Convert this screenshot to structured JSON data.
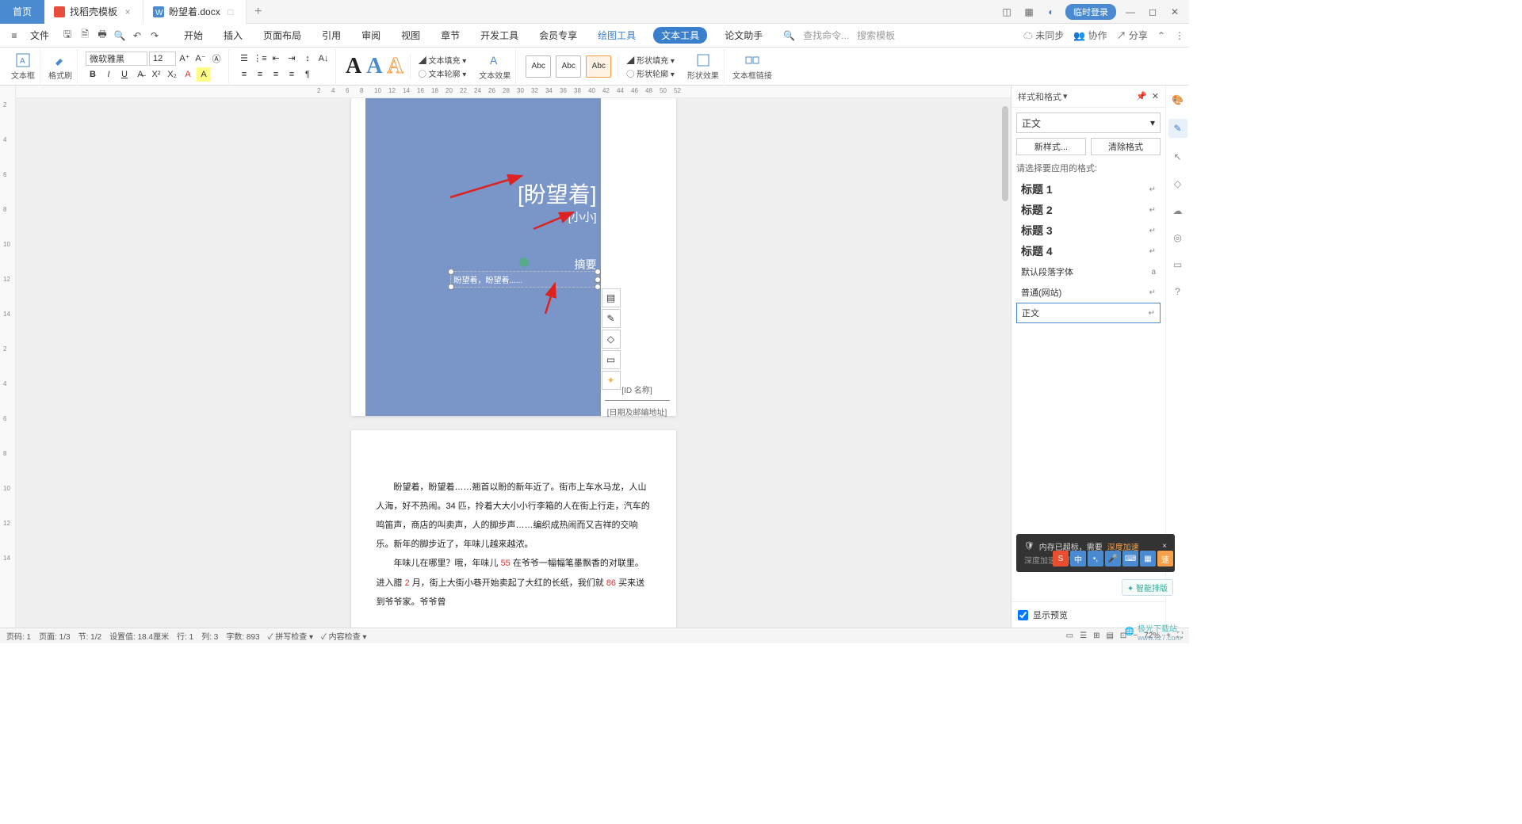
{
  "titlebar": {
    "home": "首页",
    "tabs": [
      {
        "label": "找稻壳模板",
        "icon_color": "#e74c3c"
      },
      {
        "label": "盼望着.docx",
        "icon_color": "#4a8ad0"
      }
    ],
    "login": "临时登录"
  },
  "menubar": {
    "file": "文件",
    "items": [
      "开始",
      "插入",
      "页面布局",
      "引用",
      "审阅",
      "视图",
      "章节",
      "开发工具",
      "会员专享"
    ],
    "draw_tool": "绘图工具",
    "text_tool": "文本工具",
    "thesis": "论文助手",
    "search_cmd": "查找命令...",
    "search_tpl": "搜索模板",
    "right": {
      "unsync": "未同步",
      "coop": "协作",
      "share": "分享"
    }
  },
  "ribbon": {
    "textbox": "文本框",
    "brush": "格式刷",
    "font_name": "微软雅黑",
    "font_size": "12",
    "text_fill": "文本填充",
    "text_outline": "文本轮廓",
    "text_effect": "文本效果",
    "shape_fill": "形状填充",
    "shape_outline": "形状轮廓",
    "shape_effect": "形状效果",
    "link": "文本框链接",
    "abc": "Abc"
  },
  "ruler_h": [
    "2",
    "4",
    "6",
    "8",
    "10",
    "12",
    "14",
    "16",
    "18",
    "20",
    "22",
    "24",
    "26",
    "28",
    "30",
    "32",
    "34",
    "36",
    "38",
    "40",
    "42",
    "44",
    "46",
    "48",
    "50",
    "52"
  ],
  "ruler_v": [
    "2",
    "4",
    "6",
    "8",
    "10",
    "12",
    "14",
    "2",
    "4",
    "6",
    "8",
    "10",
    "12",
    "14"
  ],
  "cover": {
    "title": "[盼望着]",
    "subtitle": "[小小]",
    "abstract": "摘要",
    "textbox": "盼望着，盼望着......",
    "id_label": "[ID 名称]",
    "date_label": "[日期及邮编地址]"
  },
  "page2": {
    "p1_a": "盼望着，盼望着……翘首以盼的新年近了。街市上车水马龙，人山人海，好不热闹。34 匹，拎着大大小小行李箱的人在街上行走，汽车的鸣笛声，商店的叫卖声，人的脚步声……编织成热闹而又吉祥的交响乐。新年的脚步近了，年味儿越来越浓。",
    "p2_a": "年味儿在哪里？哦，年味儿 ",
    "p2_red1": "55",
    "p2_b": " 在爷爷一幅幅笔墨飘香的对联里。进入腊 ",
    "p2_red2": "2",
    "p2_c": " 月，街上大街小巷开始卖起了大红的长纸，我们就 ",
    "p2_red3": "86",
    "p2_d": " 买来送到爷爷家。爷爷曾"
  },
  "panel": {
    "title": "样式和格式",
    "current": "正文",
    "new_style": "新样式...",
    "clear": "清除格式",
    "apply_label": "请选择要应用的格式:",
    "styles": [
      "标题 1",
      "标题 2",
      "标题 3",
      "标题 4"
    ],
    "default_font": "默认段落字体",
    "normal_web": "普通(网站)",
    "body": "正文",
    "show_preview": "显示预览",
    "smart": "智能排版"
  },
  "status": {
    "page_no": "页码: 1",
    "pages": "页面: 1/3",
    "section": "节: 1/2",
    "pos": "设置值: 18.4厘米",
    "line": "行: 1",
    "col": "列: 3",
    "words": "字数: 893",
    "spell": "拼写检查",
    "content": "内容检查",
    "zoom": "72%"
  },
  "notif": {
    "line1a": "内存已超标，需要 ",
    "line1b": "深度加速",
    "line2": "深度加速关闭"
  },
  "watermark": {
    "site": "极光下载站",
    "url": "www.xz7.com"
  }
}
